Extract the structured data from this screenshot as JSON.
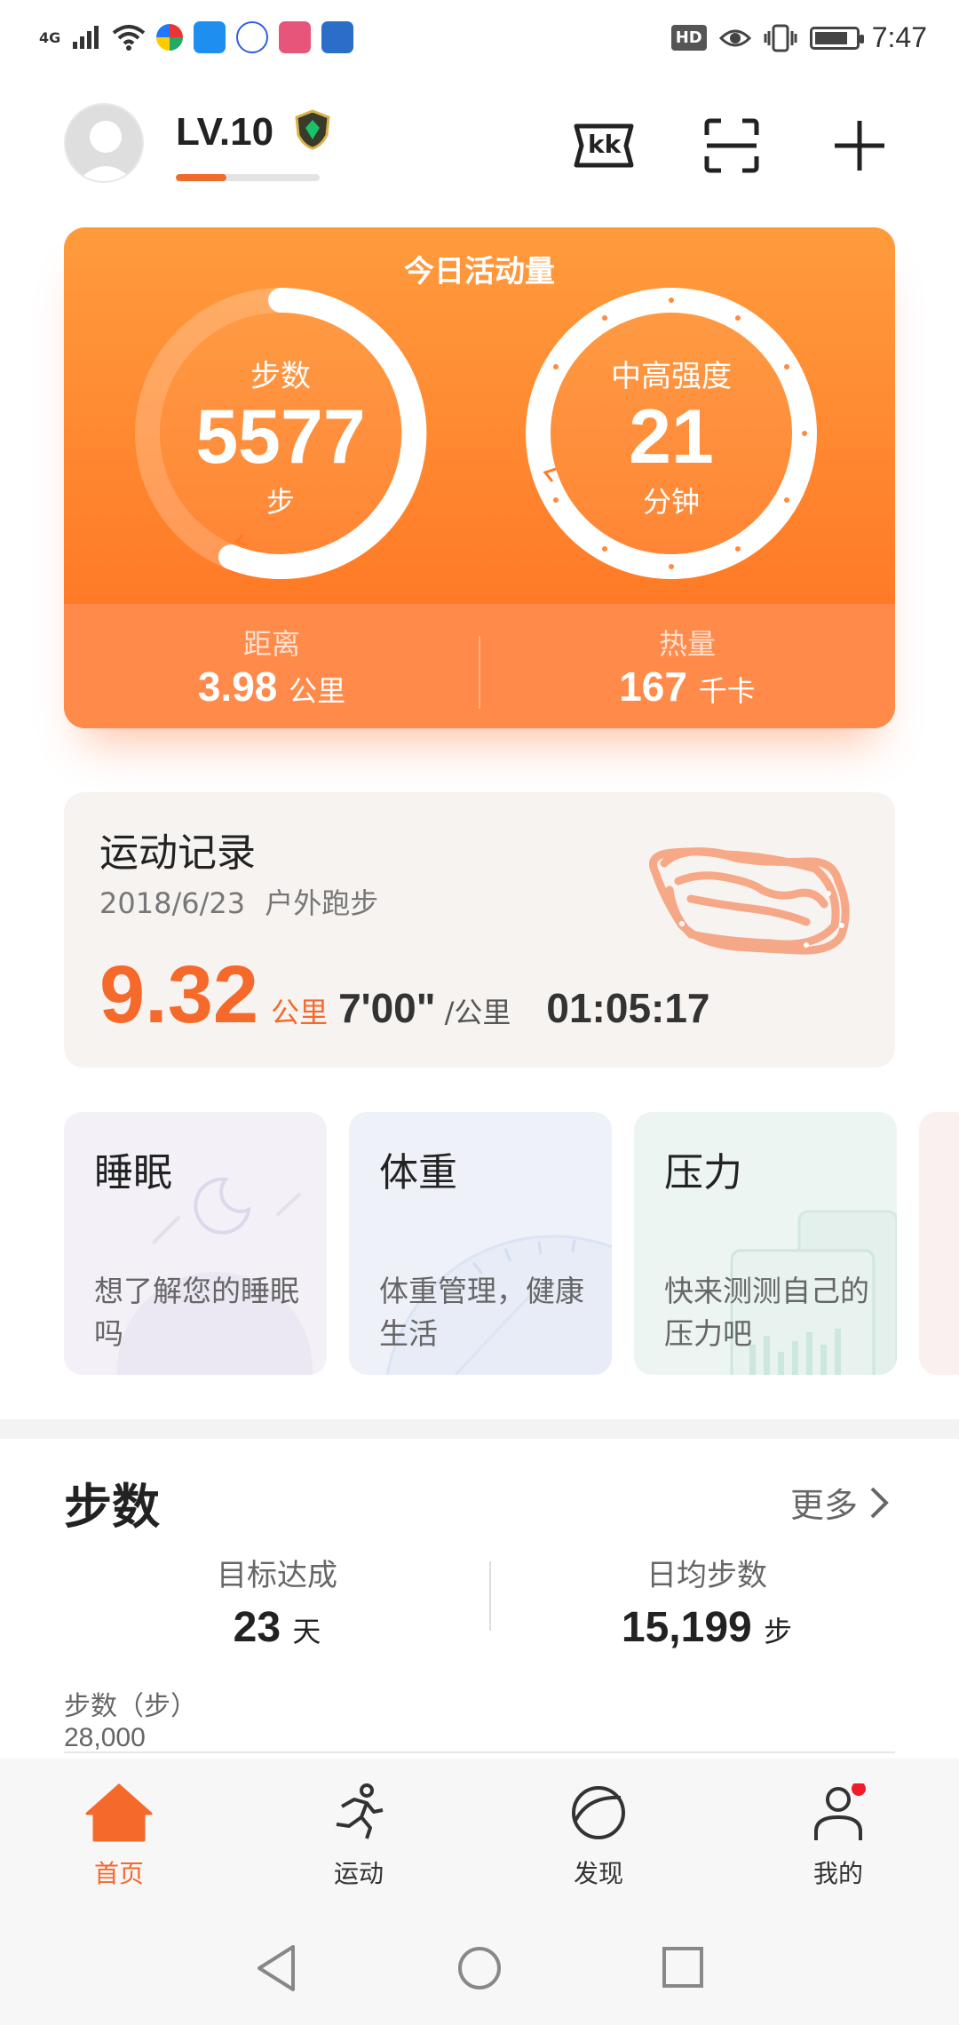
{
  "status_bar": {
    "network": "4G",
    "hd": "HD",
    "time": "7:47",
    "battery_level": 0.85
  },
  "header": {
    "level": "LV.10",
    "level_progress": 0.35,
    "kk_label": "kk"
  },
  "activity": {
    "title": "今日活动量",
    "steps_label": "步数",
    "steps_value": "5577",
    "steps_unit": "步",
    "intensity_label": "中高强度",
    "intensity_value": "21",
    "intensity_unit": "分钟",
    "distance_label": "距离",
    "distance_value": "3.98",
    "distance_unit": "公里",
    "calories_label": "热量",
    "calories_value": "167",
    "calories_unit": "千卡"
  },
  "record": {
    "title": "运动记录",
    "date": "2018/6/23",
    "type": "户外跑步",
    "distance": "9.32",
    "distance_unit": "公里",
    "pace": "7'00\"",
    "pace_unit": "/公里",
    "duration": "01:05:17"
  },
  "mini_cards": [
    {
      "title": "睡眠",
      "desc": "想了解您的睡眠吗"
    },
    {
      "title": "体重",
      "desc": "体重管理，健康生活"
    },
    {
      "title": "压力",
      "desc": "快来测测自己的压力吧"
    }
  ],
  "steps_section": {
    "title": "步数",
    "more": "更多",
    "goal_label": "目标达成",
    "goal_value": "23",
    "goal_unit": "天",
    "avg_label": "日均步数",
    "avg_value": "15,199",
    "avg_unit": "步",
    "chart_label": "步数（步）",
    "chart_max": "28,000"
  },
  "nav": [
    {
      "label": "首页",
      "icon": "home-icon",
      "active": true
    },
    {
      "label": "运动",
      "icon": "running-icon",
      "active": false
    },
    {
      "label": "发现",
      "icon": "discover-icon",
      "active": false
    },
    {
      "label": "我的",
      "icon": "profile-icon",
      "active": false
    }
  ],
  "colors": {
    "accent": "#f5692b",
    "card_orange": "#ff8a3d"
  }
}
